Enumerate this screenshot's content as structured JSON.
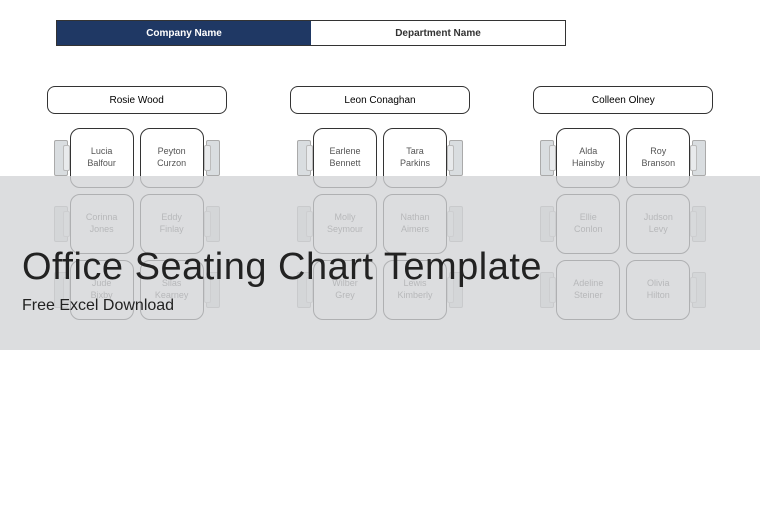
{
  "header": {
    "company_label": "Company Name",
    "dept_label": "Department Name"
  },
  "overlay": {
    "title": "Office Seating Chart Template",
    "subtitle": "Free Excel Download"
  },
  "clusters": [
    {
      "leader": "Rosie Wood",
      "seats": [
        {
          "first": "Lucia",
          "last": "Balfour"
        },
        {
          "first": "Peyton",
          "last": "Curzon"
        },
        {
          "first": "Corinna",
          "last": "Jones"
        },
        {
          "first": "Eddy",
          "last": "Finlay"
        },
        {
          "first": "Jude",
          "last": "Bixby"
        },
        {
          "first": "Silas",
          "last": "Kearney"
        }
      ]
    },
    {
      "leader": "Leon Conaghan",
      "seats": [
        {
          "first": "Earlene",
          "last": "Bennett"
        },
        {
          "first": "Tara",
          "last": "Parkins"
        },
        {
          "first": "Molly",
          "last": "Seymour"
        },
        {
          "first": "Nathan",
          "last": "Aimers"
        },
        {
          "first": "Wilber",
          "last": "Grey"
        },
        {
          "first": "Lewis",
          "last": "Kimberly"
        }
      ]
    },
    {
      "leader": "Colleen Olney",
      "seats": [
        {
          "first": "Alda",
          "last": "Hainsby"
        },
        {
          "first": "Roy",
          "last": "Branson"
        },
        {
          "first": "Ellie",
          "last": "Conlon"
        },
        {
          "first": "Judson",
          "last": "Levy"
        },
        {
          "first": "Adeline",
          "last": "Steiner"
        },
        {
          "first": "Olivia",
          "last": "Hilton"
        }
      ]
    }
  ]
}
